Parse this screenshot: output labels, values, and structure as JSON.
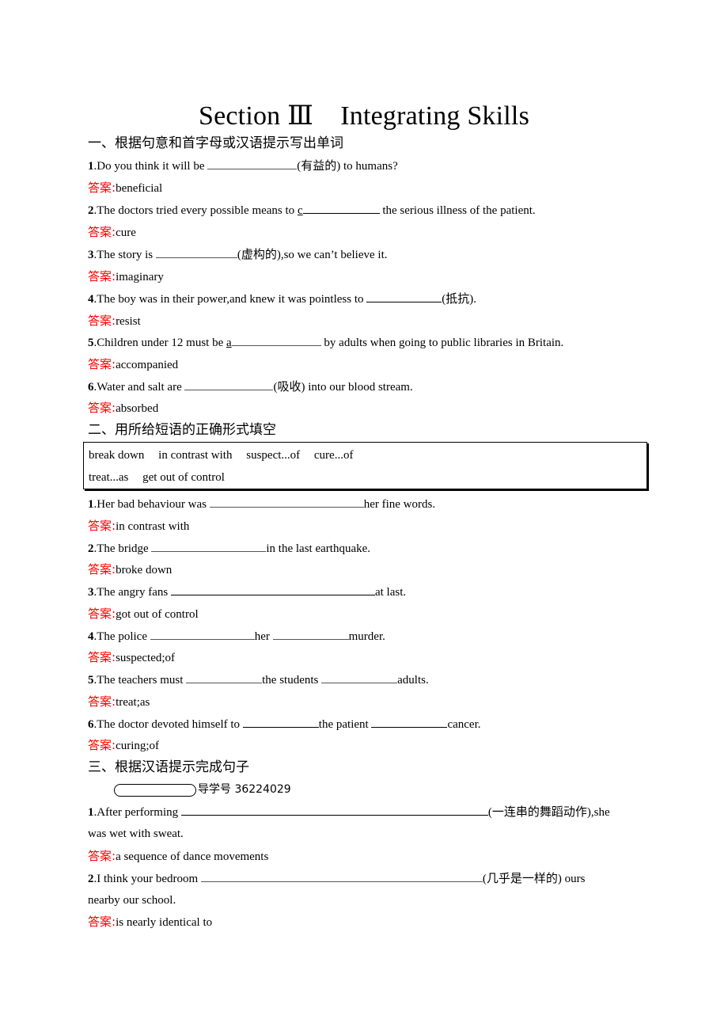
{
  "title": "Section Ⅲ　Integrating Skills",
  "answer_label": "答案:",
  "section1": {
    "heading": "一、根据句意和首字母或汉语提示写出单词",
    "items": [
      {
        "num": "1",
        "pre": ".Do you think it will be ",
        "hint_letter": "",
        "post": "(有益的) to humans?",
        "answer": "beneficial"
      },
      {
        "num": "2",
        "pre": ".The doctors tried every possible means to ",
        "hint_letter": "c",
        "post": " the serious illness of the patient.",
        "answer": "cure"
      },
      {
        "num": "3",
        "pre": ".The story is ",
        "hint_letter": "",
        "post": "(虚构的),so we can’t believe it.",
        "answer": "imaginary"
      },
      {
        "num": "4",
        "pre": ".The boy was in their power,and knew it was pointless to ",
        "hint_letter": "",
        "post": "(抵抗).",
        "answer": "resist"
      },
      {
        "num": "5",
        "pre": ".Children under 12 must be ",
        "hint_letter": "a",
        "post": " by adults when going to public libraries in Britain.",
        "answer": "accompanied"
      },
      {
        "num": "6",
        "pre": ".Water and salt are ",
        "hint_letter": "",
        "post": "(吸收) into our blood stream.",
        "answer": "absorbed"
      }
    ]
  },
  "section2": {
    "heading": "二、用所给短语的正确形式填空",
    "phrase_box": {
      "row1": [
        "break down",
        "in contrast with",
        "suspect...of",
        "cure...of"
      ],
      "row2": [
        "treat...as",
        "get out of control"
      ]
    },
    "items": [
      {
        "num": "1",
        "parts": [
          ".Her bad behaviour was ",
          "her fine words."
        ],
        "answer": "in contrast with"
      },
      {
        "num": "2",
        "parts": [
          ".The bridge ",
          "in the last earthquake."
        ],
        "answer": "broke down"
      },
      {
        "num": "3",
        "parts": [
          ".The angry fans ",
          "at last."
        ],
        "answer": "got out of control"
      },
      {
        "num": "4",
        "parts": [
          ".The police ",
          "her ",
          "murder."
        ],
        "answer": "suspected;of"
      },
      {
        "num": "5",
        "parts": [
          ".The teachers must ",
          "the students ",
          "adults."
        ],
        "answer": "treat;as"
      },
      {
        "num": "6",
        "parts": [
          ".The doctor devoted himself to ",
          "the patient ",
          "cancer."
        ],
        "answer": "curing;of"
      }
    ]
  },
  "section3": {
    "heading": "三、根据汉语提示完成句子",
    "guide_label": "导学号 36224029",
    "items": [
      {
        "num": "1",
        "pre": ".After performing ",
        "post": "(一连串的舞蹈动作),she",
        "cont": "was wet with sweat.",
        "answer": "a sequence of dance movements"
      },
      {
        "num": "2",
        "pre": ".I think your bedroom ",
        "post": "(几乎是一样的) ours",
        "cont": "nearby our school.",
        "answer": "is nearly identical to"
      }
    ]
  }
}
